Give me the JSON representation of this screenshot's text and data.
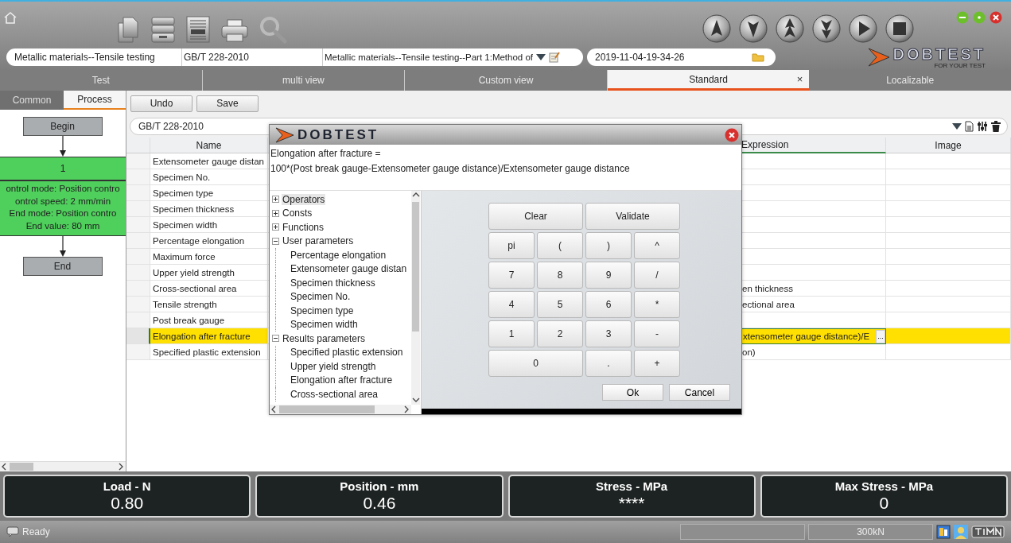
{
  "fields": {
    "test_name": "Metallic materials--Tensile testing",
    "standard": "GB/T 228-2010",
    "standard_title": "Metallic materials--Tensile testing--Part 1:Method of",
    "timestamp": "2019-11-04-19-34-26"
  },
  "logo": {
    "name": "DOBTEST",
    "tagline": "FOR YOUR TEST"
  },
  "tabs": [
    {
      "label": "Test",
      "selected": false
    },
    {
      "label": "multi view",
      "selected": false
    },
    {
      "label": "Custom view",
      "selected": false
    },
    {
      "label": "Standard",
      "selected": true,
      "close": "×"
    },
    {
      "label": "Localizable",
      "selected": false
    }
  ],
  "left_panel": {
    "tabs": [
      {
        "label": "Common",
        "selected": false
      },
      {
        "label": "Process",
        "selected": true
      }
    ],
    "flow": {
      "begin": "Begin",
      "step": {
        "number": "1",
        "lines": [
          "ontrol mode: Position contro",
          "ontrol speed: 2 mm/min",
          "End mode: Position contro",
          "End value: 80 mm"
        ]
      },
      "end": "End"
    }
  },
  "toolbar": {
    "buttons": [
      "Undo",
      "Save"
    ]
  },
  "standard_combo": {
    "value": "GB/T 228-2010"
  },
  "table": {
    "columns": {
      "name": "Name",
      "expression": "Expression",
      "image": "Image"
    },
    "rows": [
      {
        "name": "Extensometer gauge distan",
        "selected": false
      },
      {
        "name": "Specimen No.",
        "selected": false
      },
      {
        "name": "Specimen type",
        "selected": false
      },
      {
        "name": "Specimen thickness",
        "selected": false
      },
      {
        "name": "Specimen width",
        "selected": false
      },
      {
        "name": "Percentage elongation",
        "selected": false
      },
      {
        "name": "Maximum force",
        "selected": false
      },
      {
        "name": "Upper yield strength",
        "selected": false
      },
      {
        "name": "Cross-sectional area",
        "expression": "en thickness",
        "selected": false
      },
      {
        "name": "Tensile strength",
        "expression": "ectional area",
        "selected": false
      },
      {
        "name": "Post break gauge",
        "selected": false
      },
      {
        "name": "Elongation after fracture",
        "expression": "xtensometer gauge distance)/E",
        "editor_button": "...",
        "selected": true
      },
      {
        "name": "Specified plastic extension",
        "expression": "on)",
        "selected": false
      }
    ]
  },
  "dialog": {
    "logo": "DOBTEST",
    "formula": [
      "Elongation after fracture =",
      "100*(Post break gauge-Extensometer gauge distance)/Extensometer gauge distance"
    ],
    "tree": [
      {
        "label": "Operators",
        "expanded": false,
        "selected": true
      },
      {
        "label": "Consts",
        "expanded": false,
        "selected": false
      },
      {
        "label": "Functions",
        "expanded": false,
        "selected": false
      },
      {
        "label": "User parameters",
        "expanded": true,
        "selected": false,
        "children": [
          {
            "label": "Percentage elongation",
            "selected": false
          },
          {
            "label": "Extensometer gauge distan",
            "selected": false
          },
          {
            "label": "Specimen thickness",
            "selected": false
          },
          {
            "label": "Specimen No.",
            "selected": false
          },
          {
            "label": "Specimen type",
            "selected": false
          },
          {
            "label": "Specimen width",
            "selected": false
          }
        ]
      },
      {
        "label": "Results parameters",
        "expanded": true,
        "selected": false,
        "children": [
          {
            "label": "Specified plastic extension",
            "selected": false
          },
          {
            "label": "Upper yield strength",
            "selected": false
          },
          {
            "label": "Elongation after fracture",
            "selected": false
          },
          {
            "label": "Cross-sectional area",
            "selected": false
          }
        ]
      }
    ],
    "keypad": [
      [
        {
          "label": "Clear",
          "kind": "wide"
        },
        {
          "label": "Validate",
          "kind": "wide"
        }
      ],
      [
        {
          "label": "pi",
          "kind": "key"
        },
        {
          "label": "(",
          "kind": "key"
        },
        {
          "label": ")",
          "kind": "key"
        },
        {
          "label": "^",
          "kind": "key"
        }
      ],
      [
        {
          "label": "7",
          "kind": "key"
        },
        {
          "label": "8",
          "kind": "key"
        },
        {
          "label": "9",
          "kind": "key"
        },
        {
          "label": "/",
          "kind": "key"
        }
      ],
      [
        {
          "label": "4",
          "kind": "key"
        },
        {
          "label": "5",
          "kind": "key"
        },
        {
          "label": "6",
          "kind": "key"
        },
        {
          "label": "*",
          "kind": "key"
        }
      ],
      [
        {
          "label": "1",
          "kind": "key"
        },
        {
          "label": "2",
          "kind": "key"
        },
        {
          "label": "3",
          "kind": "key"
        },
        {
          "label": "-",
          "kind": "key"
        }
      ],
      [
        {
          "label": "0",
          "kind": "wide"
        },
        {
          "label": ".",
          "kind": "key"
        },
        {
          "label": "+",
          "kind": "key"
        }
      ]
    ],
    "buttons": [
      "Ok",
      "Cancel"
    ]
  },
  "meters": [
    {
      "label": "Load - N",
      "value": "0.80"
    },
    {
      "label": "Position - mm",
      "value": "0.46"
    },
    {
      "label": "Stress - MPa",
      "value": "****"
    },
    {
      "label": "Max Stress - MPa",
      "value": "0"
    }
  ],
  "status_bar": {
    "text": "Ready",
    "capacity": "300kN"
  }
}
